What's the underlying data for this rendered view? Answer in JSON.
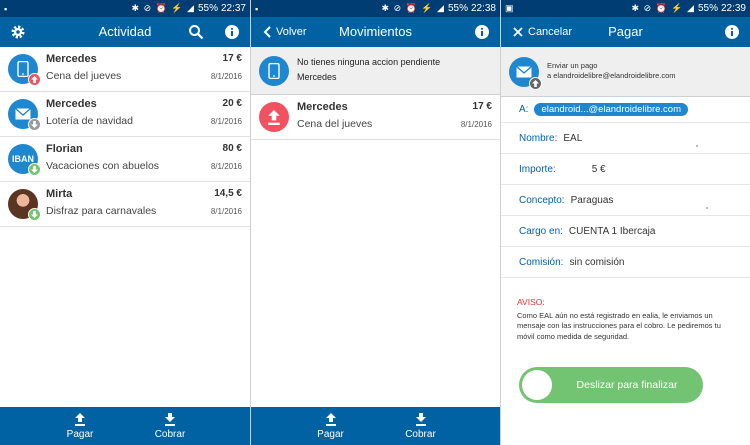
{
  "screens": [
    {
      "status": {
        "icons": "✱ ⊘ ⏰ ⚡ ◢",
        "battery": "55%",
        "time": "22:37"
      },
      "appbar": {
        "title": "Actividad"
      },
      "items": [
        {
          "name": "Mercedes",
          "concept": "Cena del jueves",
          "amount": "17 €",
          "date": "8/1/2016"
        },
        {
          "name": "Mercedes",
          "concept": "Lotería de navidad",
          "amount": "20 €",
          "date": "8/1/2016"
        },
        {
          "name": "Florian",
          "concept": "Vacaciones con abuelos",
          "amount": "80 €",
          "date": "8/1/2016",
          "avatar_text": "IBAN"
        },
        {
          "name": "Mirta",
          "concept": "Disfraz para carnavales",
          "amount": "14,5 €",
          "date": "8/1/2016"
        }
      ],
      "bottom": {
        "pay": "Pagar",
        "collect": "Cobrar"
      }
    },
    {
      "status": {
        "icons": "✱ ⊘ ⏰ ⚡ ◢",
        "battery": "55%",
        "time": "22:38"
      },
      "appbar": {
        "back": "Volver",
        "title": "Movimientos"
      },
      "pending": {
        "line1": "No tienes ninguna accion pendiente",
        "line2": "Mercedes"
      },
      "items": [
        {
          "name": "Mercedes",
          "concept": "Cena del jueves",
          "amount": "17 €",
          "date": "8/1/2016"
        }
      ],
      "bottom": {
        "pay": "Pagar",
        "collect": "Cobrar"
      }
    },
    {
      "status": {
        "icons": "✱ ⊘ ⏰ ⚡ ◢",
        "battery": "55%",
        "time": "22:39"
      },
      "appbar": {
        "cancel": "Cancelar",
        "title": "Pagar"
      },
      "paybox": {
        "line1": "Enviar un pago",
        "line2": "a elandroidelibre@elandroidelibre.com"
      },
      "fields": {
        "to_label": "A:",
        "to_value": "elandroid...@elandroidelibre.com",
        "name_label": "Nombre:",
        "name_value": "EAL",
        "amount_label": "Importe:",
        "amount_value": "5 €",
        "concept_label": "Concepto:",
        "concept_value": "Paraguas",
        "charge_label": "Cargo en:",
        "charge_value": "CUENTA 1 Ibercaja",
        "fee_label": "Comisión:",
        "fee_value": "sin comisión"
      },
      "notice": {
        "title": "AVISO:",
        "text": "Como EAL aún no está registrado en ealia, le enviamos un mensaje con las instrucciones para el cobro. Le pediremos tu móvil como medida de seguridad."
      },
      "slider": {
        "label": "Deslizar para finalizar"
      }
    }
  ],
  "colors": {
    "appbar": "#0062a3",
    "statusbar": "#003d73",
    "accent": "#1e87d0",
    "pay_red": "#f05262",
    "badge_green": "#72c472",
    "slider_green": "#72c472",
    "warning": "#e4322b"
  }
}
